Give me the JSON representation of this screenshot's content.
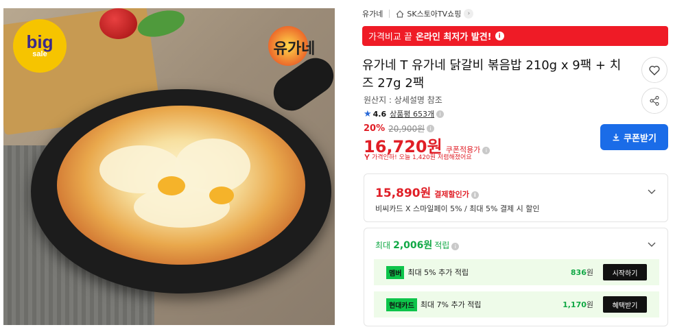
{
  "breadcrumb": {
    "store": "유가네",
    "mall": "SK스토아TV쇼핑"
  },
  "banner": {
    "prefix": "가격비교 끝",
    "highlight": "온라인 최저가 발견!"
  },
  "product": {
    "title": "유가네 T 유가네 닭갈비 볶음밥 210g x 9팩 + 치즈 27g 2팩",
    "origin": "원산지 : 상세설명 참조",
    "rating": "4.6",
    "reviews": "상품평 653개",
    "discount": "20%",
    "original_price": "20,900원",
    "price": "16,720원",
    "price_note": "쿠폰적용가",
    "price_drop": "가격인하! 오늘 1,420원 저렴해졌어요"
  },
  "coupon_button": "쿠폰받기",
  "payment": {
    "price": "15,890원",
    "label": "결제할인가",
    "desc": "비씨카드 X 스마일페이 5% / 최대 5% 결제 시 할인"
  },
  "points": {
    "prefix": "최대",
    "amount": "2,006원",
    "suffix": "적립",
    "rows": [
      {
        "tag": "멤버",
        "text": "최대 5% 추가 적립",
        "amount": "836",
        "unit": "원",
        "button": "시작하기"
      },
      {
        "tag": "현대카드",
        "text": "최대 7% 추가 적립",
        "amount": "1,170",
        "unit": "원",
        "button": "혜택받기"
      }
    ]
  },
  "image": {
    "badge_big": "big",
    "badge_sale": "sale",
    "logo": "유가네"
  },
  "colors": {
    "accent_red": "#ef1b26",
    "coupon_blue": "#1a6ce8",
    "point_green": "#11a845"
  }
}
